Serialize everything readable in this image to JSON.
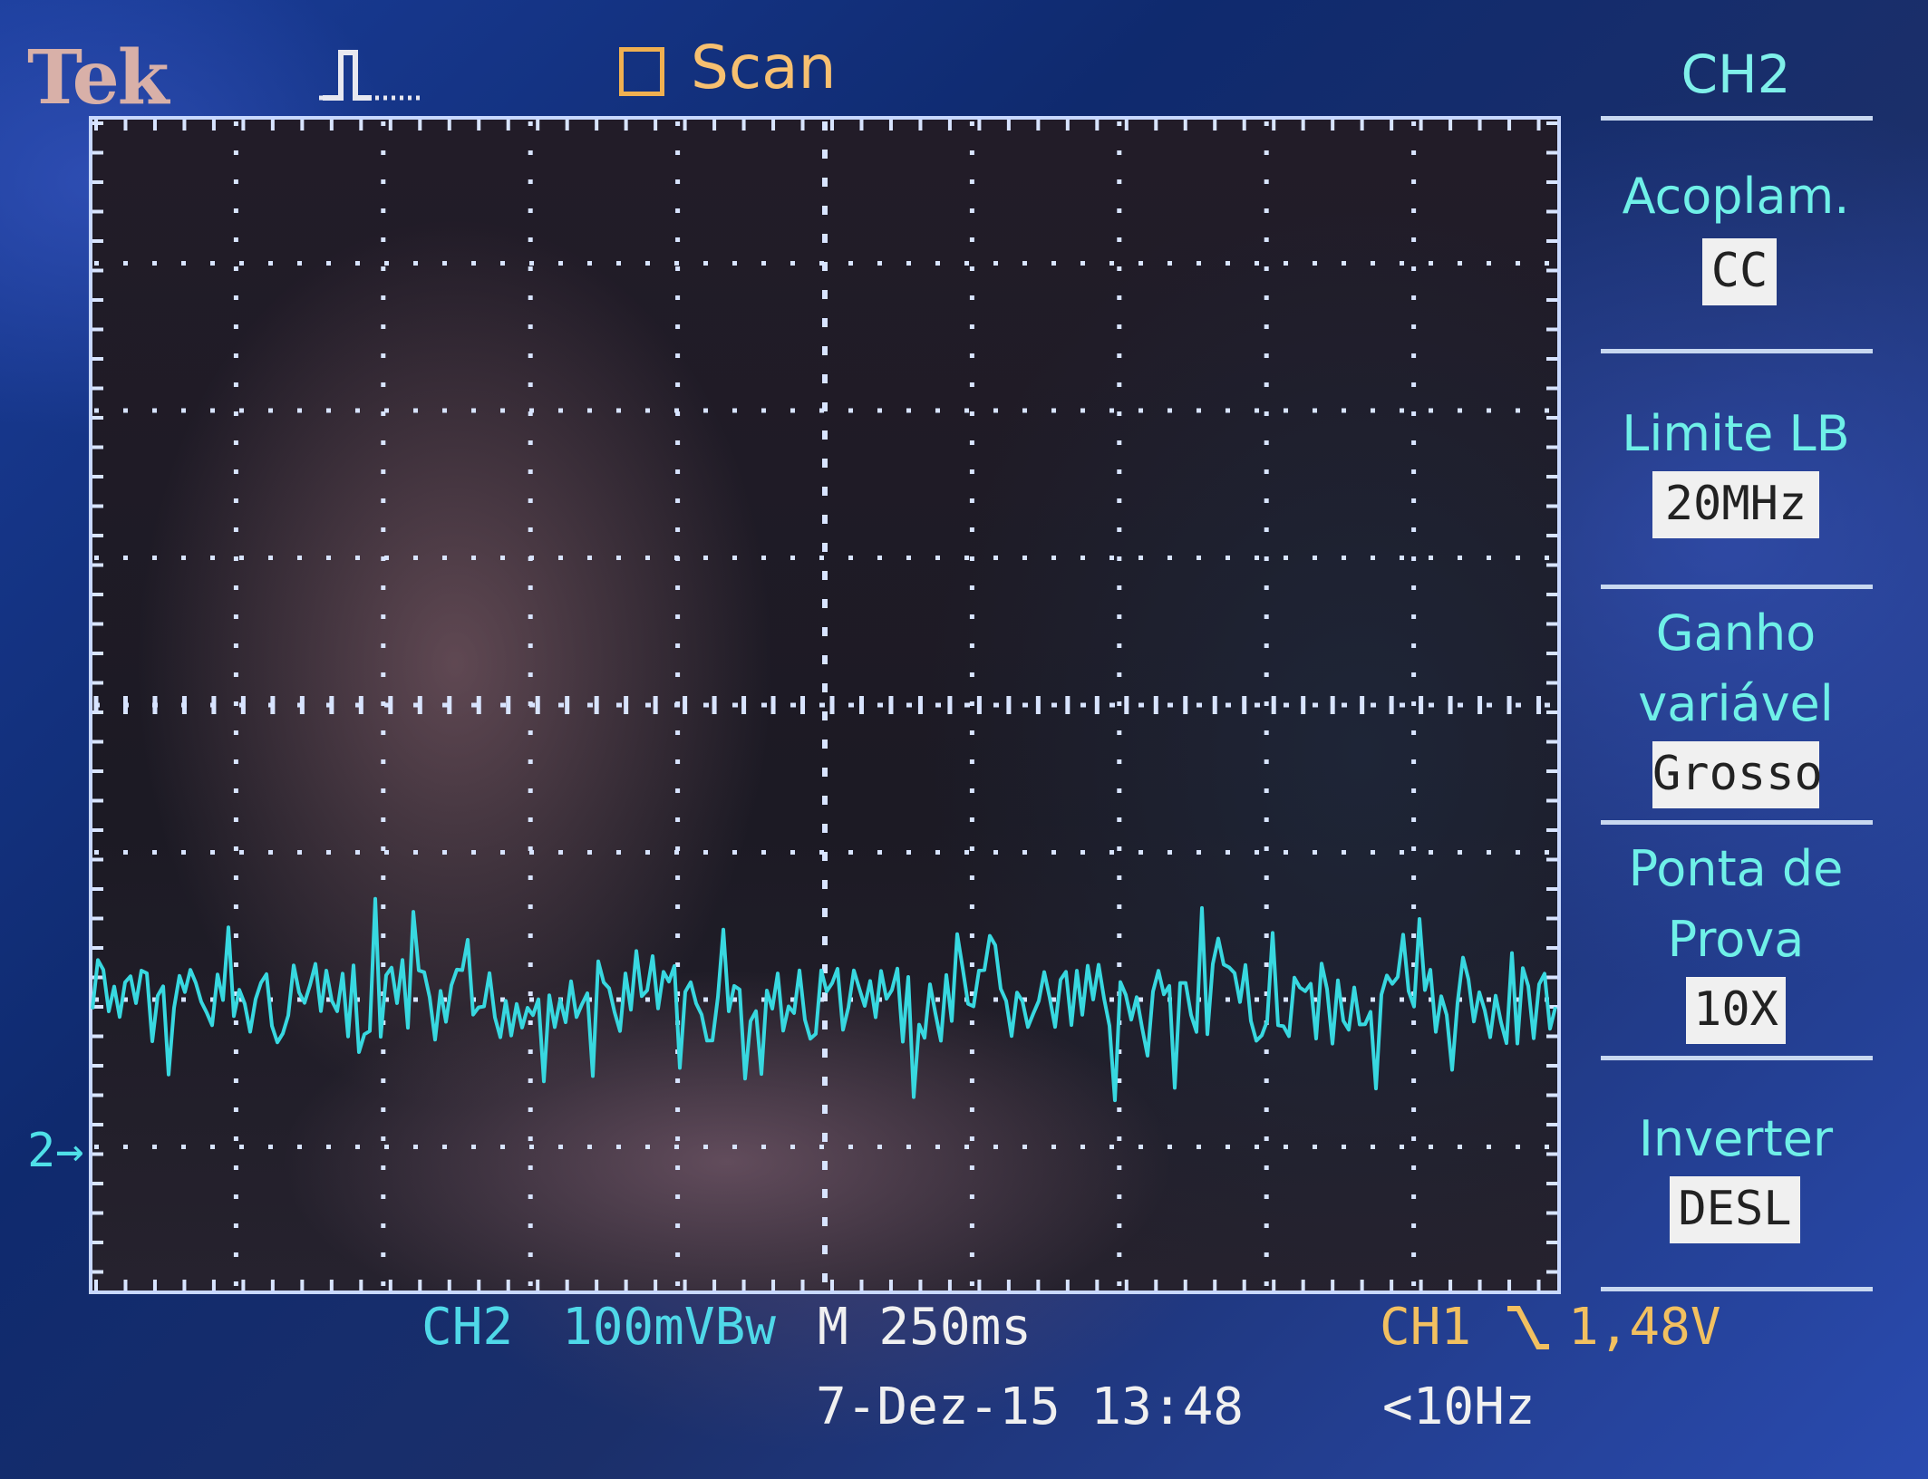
{
  "header": {
    "brand": "Tek",
    "trigger_icon": "pulse-trigger-icon",
    "acquisition_mode": "Scan"
  },
  "display": {
    "channel_marker": "2",
    "trace_color": "#38d8e0",
    "grid_color": "#d8e4ff"
  },
  "menu": {
    "title": "CH2",
    "items": [
      {
        "label_lines": [
          "Acoplam."
        ],
        "value": "CC"
      },
      {
        "label_lines": [
          "Limite LB"
        ],
        "value": "20MHz"
      },
      {
        "label_lines": [
          "Ganho",
          "variável"
        ],
        "value": "Grosso"
      },
      {
        "label_lines": [
          "Ponta de",
          "Prova"
        ],
        "value": "10X"
      },
      {
        "label_lines": [
          "Inverter"
        ],
        "value": "DESL"
      }
    ]
  },
  "status": {
    "channel": "CH2",
    "vertical_scale": "100mVBw",
    "timebase": "M 250ms",
    "trigger_source": "CH1",
    "trigger_slope_icon": "falling-edge-icon",
    "trigger_level": "1,48V",
    "datetime": "7-Dez-15 13:48",
    "frequency": "<10Hz"
  }
}
